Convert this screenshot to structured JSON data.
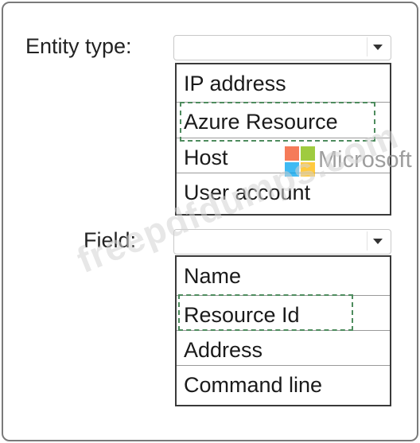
{
  "entity_type": {
    "label": "Entity type:",
    "selected_value": "",
    "options": [
      "IP address",
      "Azure Resource",
      "Host",
      "User account"
    ],
    "highlighted_option": "Azure Resource"
  },
  "field": {
    "label": "Field:",
    "selected_value": "",
    "options": [
      "Name",
      "Resource Id",
      "Address",
      "Command line"
    ],
    "highlighted_option": "Resource Id"
  },
  "watermark": {
    "text": "freepdfdumps.com",
    "brand": "Microsoft"
  },
  "colors": {
    "highlight_dash": "#4e8c5e",
    "listbox_border": "#3a3a3a",
    "logo_red": "#f25022",
    "logo_green": "#7fba00",
    "logo_blue": "#00a4ef",
    "logo_yellow": "#ffb900"
  },
  "icons": [
    "chevron-down-icon",
    "microsoft-logo-icon"
  ]
}
